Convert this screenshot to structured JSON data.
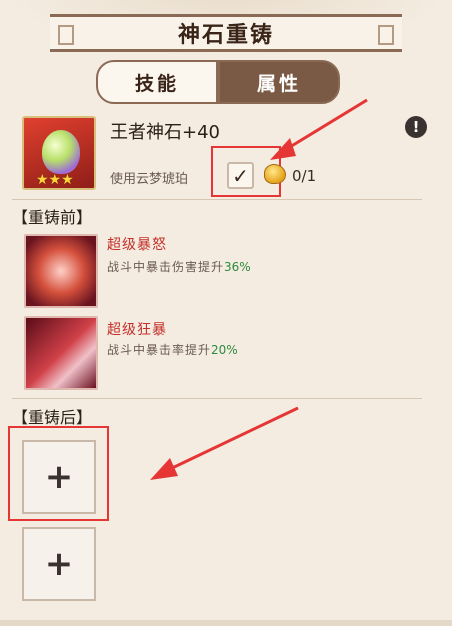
{
  "header": {
    "title": "神石重铸"
  },
  "tabs": [
    {
      "label": "技能",
      "active": false
    },
    {
      "label": "属性",
      "active": true
    }
  ],
  "item": {
    "name": "王者神石+40",
    "stars": "★★★",
    "use_label": "使用云梦琥珀",
    "checkbox_checked": true,
    "checkbox_mark": "✓",
    "amber_count": "0/1",
    "info_symbol": "!"
  },
  "before": {
    "heading": "【重铸前】",
    "skills": [
      {
        "name": "超级暴怒",
        "desc": "战斗中暴击伤害提升",
        "value": "36%"
      },
      {
        "name": "超级狂暴",
        "desc": "战斗中暴击率提升",
        "value": "20%"
      }
    ]
  },
  "after": {
    "heading": "【重铸后】",
    "slots": [
      {
        "symbol": "+"
      },
      {
        "symbol": "+"
      }
    ]
  },
  "colors": {
    "background": "#f4ece1",
    "active_tab": "#7a5a44",
    "skill_name": "#c4302a",
    "skill_value": "#2d8a3e",
    "annotation_red": "#e53535"
  }
}
